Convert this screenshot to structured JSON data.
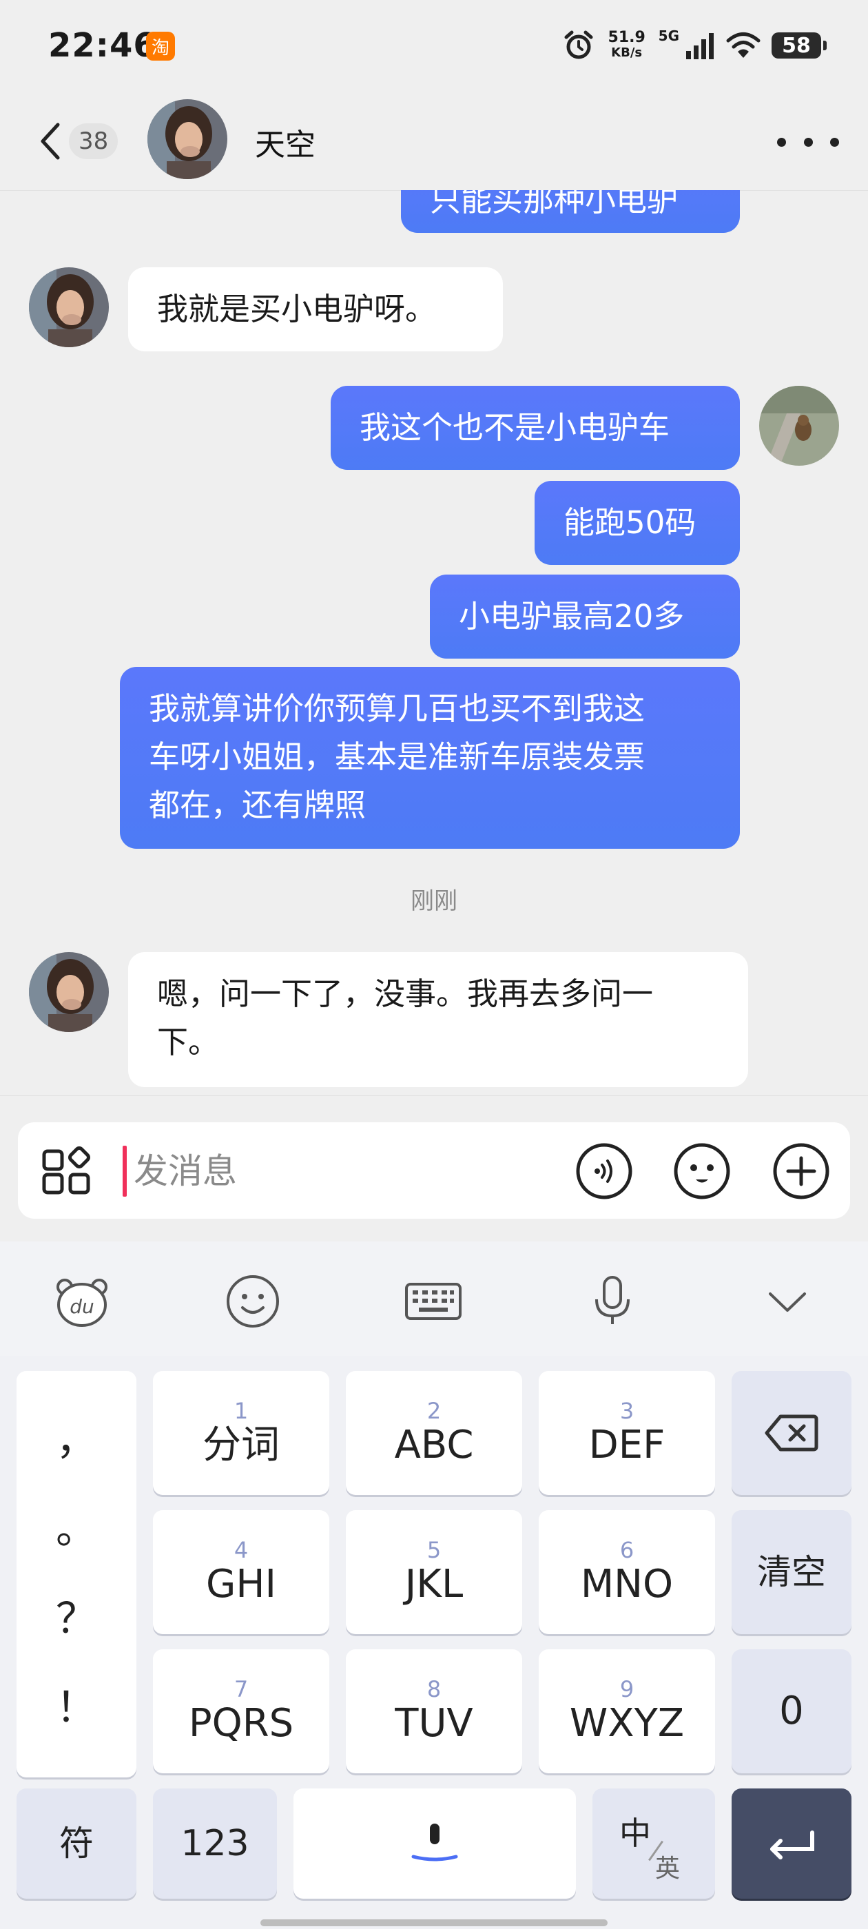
{
  "status_bar": {
    "time": "22:46",
    "app_badge": "淘",
    "net_speed_value": "51.9",
    "net_speed_unit": "KB/s",
    "signal_label": "5G",
    "battery": "58"
  },
  "header": {
    "unread_count": "38",
    "contact_name": "天空"
  },
  "messages": [
    {
      "side": "out",
      "text": "只能买那种小电驴"
    },
    {
      "side": "in",
      "text": "我就是买小电驴呀。"
    },
    {
      "side": "out",
      "text": "我这个也不是小电驴车"
    },
    {
      "side": "out",
      "text": "能跑50码"
    },
    {
      "side": "out",
      "text": "小电驴最高20多"
    },
    {
      "side": "out",
      "text_lines": [
        "我就算讲价你预算几百也买不到我这",
        "车呀小姐姐，基本是准新车原装发票",
        "都在，还有牌照"
      ]
    },
    {
      "type": "timestamp",
      "text": "刚刚"
    },
    {
      "side": "in",
      "text_lines": [
        "嗯，问一下了，没事。我再去多问一",
        "下。"
      ]
    }
  ],
  "input": {
    "placeholder": "发消息"
  },
  "keyboard": {
    "toolbar": [
      "du-bear-icon",
      "emoji-icon",
      "keyboard-icon",
      "microphone-icon",
      "collapse-chevron-icon"
    ],
    "punctuation": [
      "，",
      "。",
      "？",
      "！"
    ],
    "keys": [
      {
        "num": "1",
        "letters": "分词"
      },
      {
        "num": "2",
        "letters": "ABC"
      },
      {
        "num": "3",
        "letters": "DEF"
      },
      {
        "num": "4",
        "letters": "GHI"
      },
      {
        "num": "5",
        "letters": "JKL"
      },
      {
        "num": "6",
        "letters": "MNO"
      },
      {
        "num": "7",
        "letters": "PQRS"
      },
      {
        "num": "8",
        "letters": "TUV"
      },
      {
        "num": "9",
        "letters": "WXYZ"
      }
    ],
    "clear_label": "清空",
    "zero_label": "0",
    "symbol_label": "符",
    "numeric_label": "123",
    "lang_primary": "中",
    "lang_secondary": "英"
  }
}
